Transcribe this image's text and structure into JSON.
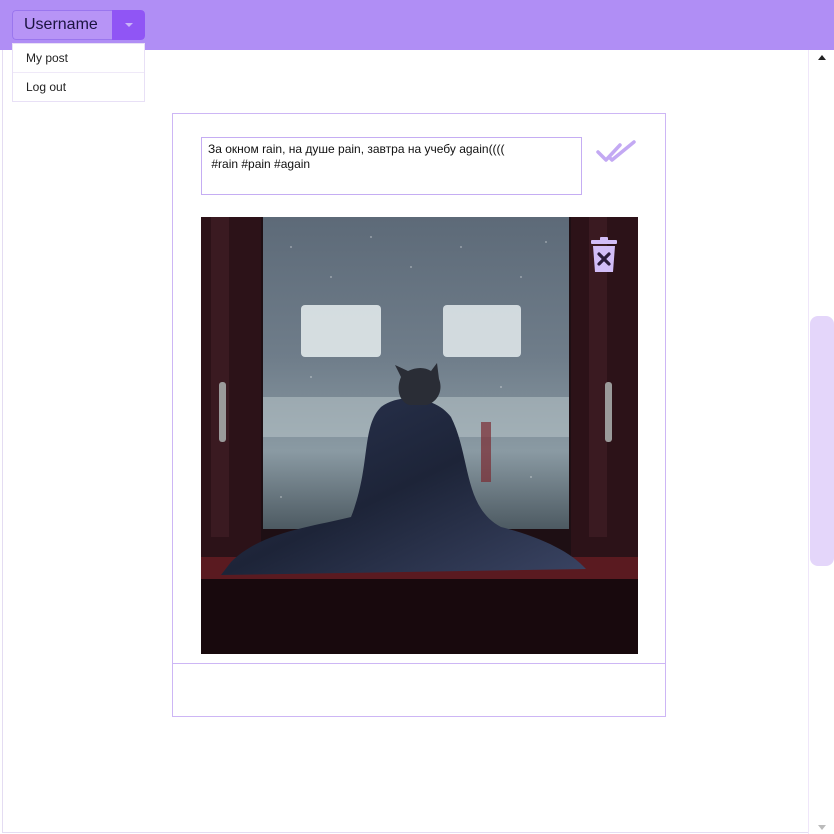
{
  "header": {
    "username": "Username",
    "caret_icon": "chevron-down-icon",
    "colors": {
      "bar": "#b08ef5",
      "dropdown": "#b794f6",
      "caret": "#9055f5"
    }
  },
  "user_menu": {
    "items": [
      {
        "label": "My post"
      },
      {
        "label": "Log out"
      }
    ]
  },
  "post": {
    "caption": "За окном rain, на душе pain, завтра на учебу again((((\n #rain #pain #again",
    "save_icon": "double-check-icon",
    "delete_icon": "trash-delete-icon",
    "image_alt": "cat wrapped in blanket at rainy window",
    "accent_color": "#cdb6f5"
  }
}
